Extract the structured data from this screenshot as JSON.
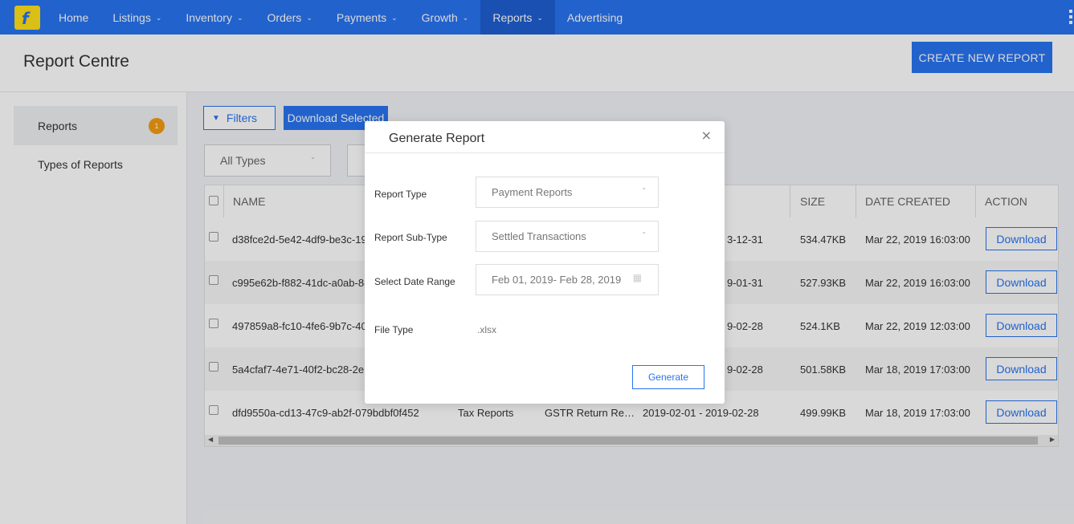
{
  "nav": {
    "logo_glyph": "f",
    "items": [
      {
        "label": "Home",
        "has_menu": false
      },
      {
        "label": "Listings",
        "has_menu": true
      },
      {
        "label": "Inventory",
        "has_menu": true
      },
      {
        "label": "Orders",
        "has_menu": true
      },
      {
        "label": "Payments",
        "has_menu": true
      },
      {
        "label": "Growth",
        "has_menu": true
      },
      {
        "label": "Reports",
        "has_menu": true,
        "active": true
      },
      {
        "label": "Advertising",
        "has_menu": false
      }
    ],
    "chevron": "⌄",
    "colors": {
      "bar": "#2874f0",
      "active": "#1f5fd0"
    }
  },
  "header": {
    "title": "Report Centre",
    "create_button": "CREATE NEW REPORT"
  },
  "sidebar": {
    "items": [
      {
        "label": "Reports",
        "badge": "1",
        "active": true
      },
      {
        "label": "Types of Reports"
      }
    ]
  },
  "toolbar": {
    "filters_label": "Filters",
    "filters_icon": "funnel-icon",
    "download_selected_label": "Download Selected",
    "type_filter_value": "All Types"
  },
  "table": {
    "headers": {
      "name": "NAME",
      "size": "SIZE",
      "date_created": "DATE CREATED",
      "action": "ACTION"
    },
    "rows": [
      {
        "name": "d38fce2d-5e42-4df9-be3c-19",
        "range_tail": "3-12-31",
        "size": "534.47KB",
        "date": "Mar 22, 2019 16:03:00",
        "action": "Download"
      },
      {
        "name": "c995e62b-f882-41dc-a0ab-88",
        "range_tail": "9-01-31",
        "size": "527.93KB",
        "date": "Mar 22, 2019 16:03:00",
        "action": "Download"
      },
      {
        "name": "497859a8-fc10-4fe6-9b7c-40",
        "range_tail": "9-02-28",
        "size": "524.1KB",
        "date": "Mar 22, 2019 12:03:00",
        "action": "Download"
      },
      {
        "name": "5a4cfaf7-4e71-40f2-bc28-2e",
        "range_tail": "9-02-28",
        "size": "501.58KB",
        "date": "Mar 18, 2019 17:03:00",
        "action": "Download"
      },
      {
        "name": "dfd9550a-cd13-47c9-ab2f-079bdbf0f452",
        "type": "Tax Reports",
        "subtype": "GSTR Return Re…",
        "range": "2019-02-01 - 2019-02-28",
        "size": "499.99KB",
        "date": "Mar 18, 2019 17:03:00",
        "action": "Download"
      }
    ]
  },
  "modal": {
    "title": "Generate Report",
    "close_glyph": "×",
    "fields": {
      "report_type_label": "Report Type",
      "report_type_value": "Payment Reports",
      "report_subtype_label": "Report Sub-Type",
      "report_subtype_value": "Settled Transactions",
      "date_range_label": "Select Date Range",
      "date_range_value": "Feb 01, 2019- Feb 28, 2019",
      "file_type_label": "File Type",
      "file_type_value": ".xlsx"
    },
    "generate_label": "Generate"
  }
}
